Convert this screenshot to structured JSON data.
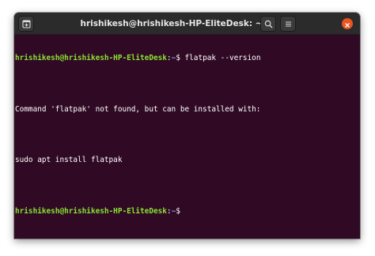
{
  "window": {
    "title": "hrishikesh@hrishikesh-HP-EliteDesk: ~"
  },
  "titlebar": {
    "icons": {
      "new_tab": "terminal-new-tab-icon",
      "search": "search-icon",
      "menu": "hamburger-menu-icon",
      "close": "close-icon"
    }
  },
  "terminal": {
    "prompt_user_host": "hrishikesh@hrishikesh-HP-EliteDesk",
    "prompt_sep": ":",
    "prompt_path": "~",
    "prompt_symbol": "$",
    "command_1": " flatpak --version",
    "output_1": "Command 'flatpak' not found, but can be installed with:",
    "output_2": "sudo apt install flatpak"
  },
  "colors": {
    "background": "#300a24",
    "prompt_user": "#8ae234",
    "prompt_path": "#729fcf",
    "text": "#ffffff",
    "close_button": "#e95420"
  }
}
